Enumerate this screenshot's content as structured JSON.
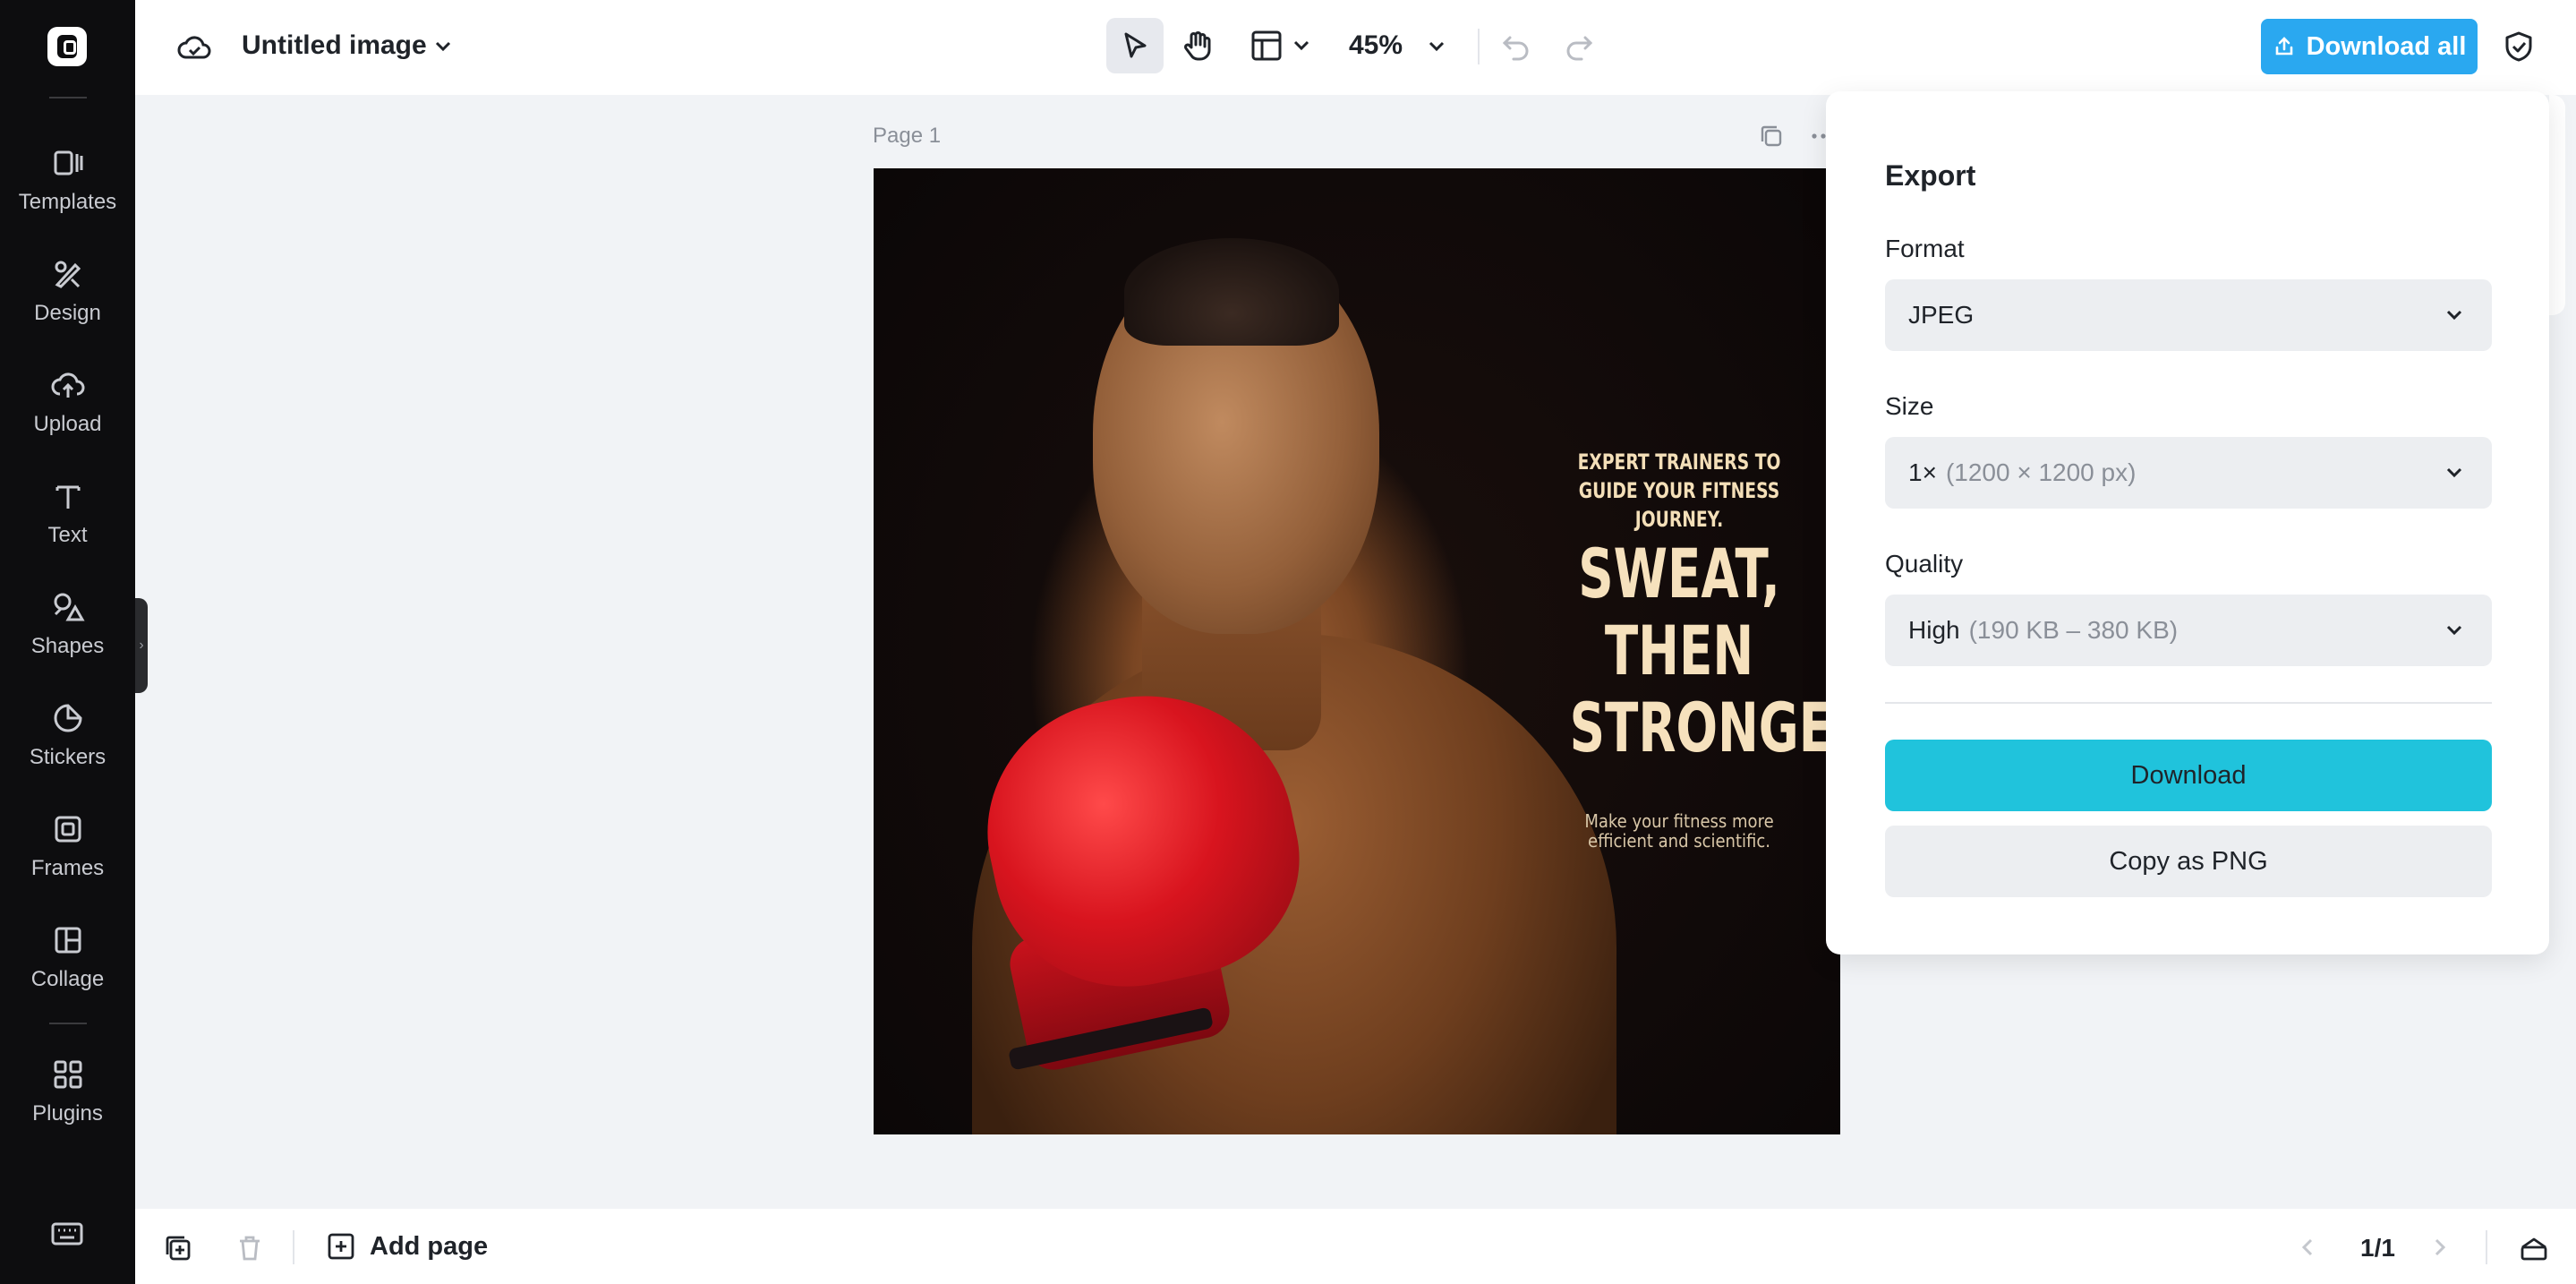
{
  "app": {
    "document_title": "Untitled image",
    "zoom": "45%"
  },
  "sidebar": {
    "items": [
      {
        "label": "Templates",
        "icon": "templates-icon"
      },
      {
        "label": "Design",
        "icon": "design-icon"
      },
      {
        "label": "Upload",
        "icon": "upload-icon"
      },
      {
        "label": "Text",
        "icon": "text-icon"
      },
      {
        "label": "Shapes",
        "icon": "shapes-icon"
      },
      {
        "label": "Stickers",
        "icon": "stickers-icon"
      },
      {
        "label": "Frames",
        "icon": "frames-icon"
      },
      {
        "label": "Collage",
        "icon": "collage-icon"
      },
      {
        "label": "Plugins",
        "icon": "plugins-icon"
      }
    ]
  },
  "toolbar": {
    "download_all_label": "Download all"
  },
  "canvas": {
    "page_label": "Page 1",
    "artwork": {
      "tagline": "EXPERT TRAINERS TO GUIDE YOUR FITNESS JOURNEY.",
      "headline_1": "SWEAT,",
      "headline_2": "THEN",
      "headline_3": "STRONGER",
      "subtext": "Make your fitness more efficient and scientific."
    }
  },
  "export_panel": {
    "title": "Export",
    "format_label": "Format",
    "format_value": "JPEG",
    "size_label": "Size",
    "size_value": "1×",
    "size_detail": "(1200 × 1200 px)",
    "quality_label": "Quality",
    "quality_value": "High",
    "quality_detail": "(190 KB – 380 KB)",
    "download_label": "Download",
    "copy_label": "Copy as PNG"
  },
  "bottombar": {
    "add_page_label": "Add page",
    "page_count": "1/1"
  },
  "colors": {
    "accent_blue": "#2aa8f0",
    "download_cyan": "#20c3dc",
    "sidebar_bg": "#0d0d0f"
  }
}
